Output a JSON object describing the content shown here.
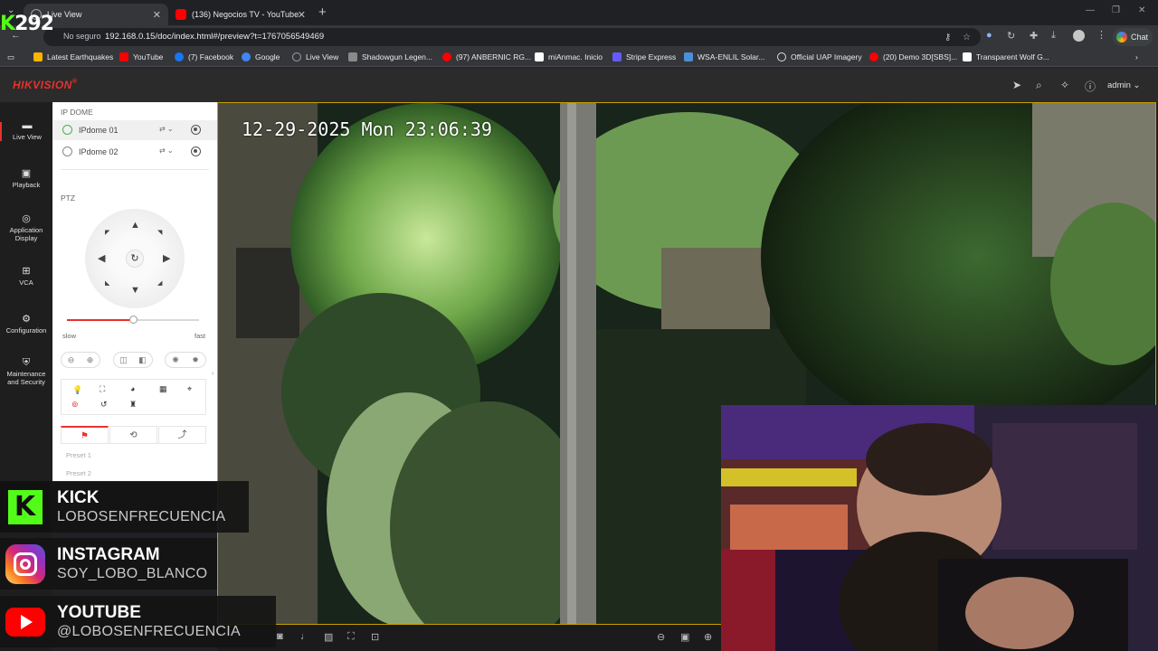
{
  "browser": {
    "tabs": [
      {
        "label": "Live View",
        "active": true,
        "color": "#9aa0a6"
      },
      {
        "label": "(136) Negocios TV - YouTube",
        "active": false,
        "color": "#ff0000"
      }
    ],
    "new_tab": "+",
    "secure_label": "No seguro",
    "url": "192.168.0.15/doc/index.html#/preview?t=1767056549469",
    "chat_label": "Chat",
    "bookmarks": [
      {
        "label": "Latest Earthquakes",
        "color": "#ffb300"
      },
      {
        "label": "YouTube",
        "color": "#ff0000"
      },
      {
        "label": "(7) Facebook",
        "color": "#1877f2"
      },
      {
        "label": "Google",
        "color": "#4285f4"
      },
      {
        "label": "Live View",
        "color": "#9aa0a6"
      },
      {
        "label": "Shadowgun Legen...",
        "color": "#8a8a8a"
      },
      {
        "label": "(97) ANBERNIC RG...",
        "color": "#ff0000"
      },
      {
        "label": "miAnmac. Inicio",
        "color": "#ffffff"
      },
      {
        "label": "Stripe Express",
        "color": "#635bff"
      },
      {
        "label": "WSA-ENLIL Solar...",
        "color": "#4a90d9"
      },
      {
        "label": "Official UAP Imagery",
        "color": "#dddddd"
      },
      {
        "label": "(20) Demo 3D[SBS]...",
        "color": "#ff0000"
      },
      {
        "label": "Transparent Wolf G...",
        "color": "#ffffff"
      }
    ]
  },
  "overlay_counter": {
    "prefix": "K",
    "value": "292"
  },
  "app": {
    "brand": "HIKVISION",
    "brand_mark": "®",
    "user": "admin",
    "accent": "#e8322d",
    "nav": [
      {
        "label": "Live View",
        "icon": "live-view-icon",
        "active": true
      },
      {
        "label": "Playback",
        "icon": "playback-icon"
      },
      {
        "label": "Application Display",
        "icon": "application-icon"
      },
      {
        "label": "VCA",
        "icon": "vca-icon"
      },
      {
        "label": "Configuration",
        "icon": "gear-icon"
      },
      {
        "label": "Maintenance and Security",
        "icon": "maintenance-icon"
      }
    ],
    "panel": {
      "group": "IP DOME",
      "cameras": [
        {
          "name": "IPdome 01",
          "selected": true
        },
        {
          "name": "IPdome 02",
          "selected": false
        }
      ],
      "ptz_title": "PTZ",
      "speed_slow": "slow",
      "speed_fast": "fast",
      "speed_value": 0.5,
      "presets": [
        "Preset 1",
        "Preset 2"
      ]
    },
    "video": {
      "osd": "12-29-2025 Mon 23:06:39"
    }
  },
  "social": [
    {
      "network": "KICK",
      "handle": "LOBOSENFRECUENCIA",
      "color": "#53fc18"
    },
    {
      "network": "INSTAGRAM",
      "handle": "SOY_LOBO_BLANCO",
      "color": "#e1306c"
    },
    {
      "network": "YOUTUBE",
      "handle": "@LOBOSENFRECUENCIA",
      "color": "#ff0000"
    }
  ]
}
